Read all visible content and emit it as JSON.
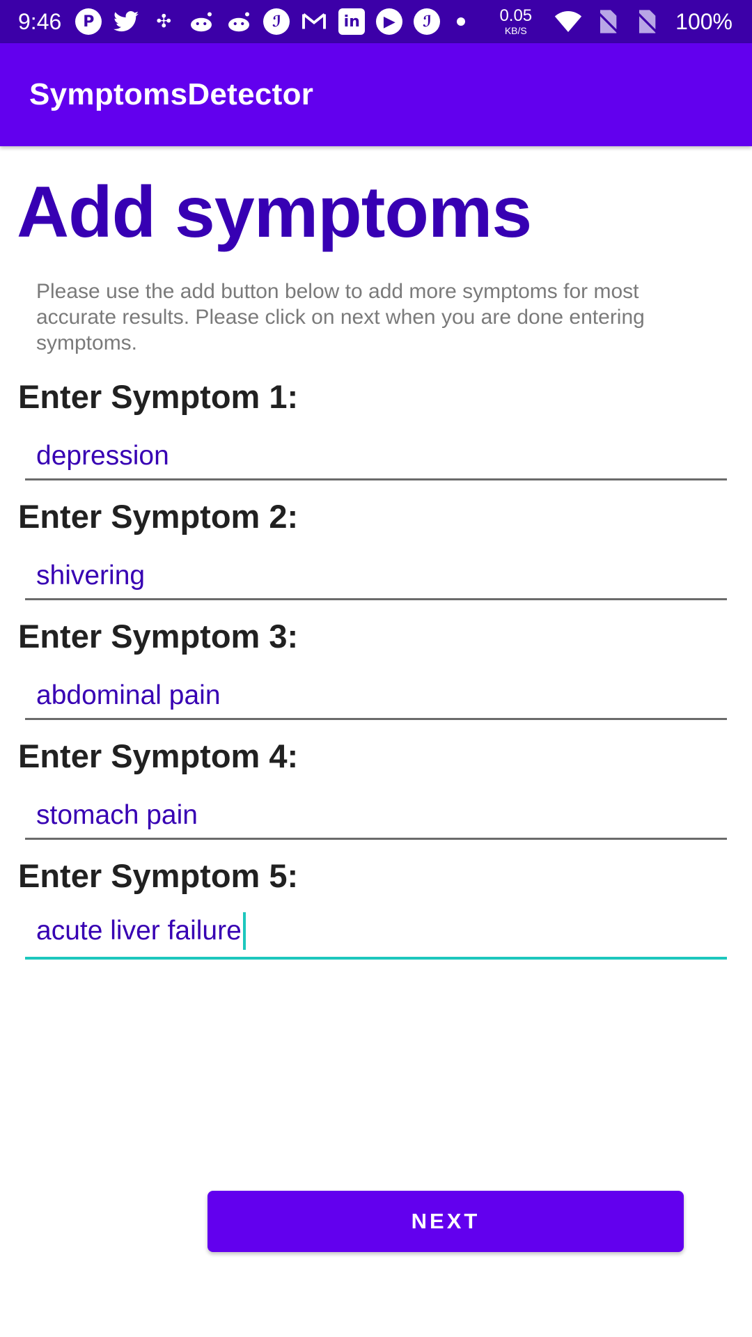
{
  "status_bar": {
    "time": "9:46",
    "notification_icons": [
      "pinterest-icon",
      "twitter-icon",
      "pinwheel-icon",
      "reddit-icon",
      "reddit-icon",
      "feather-icon",
      "gmail-icon",
      "linkedin-icon",
      "youtube-icon",
      "feather-icon",
      "dot-icon"
    ],
    "net_speed_value": "0.05",
    "net_speed_unit": "KB/S",
    "battery": "100%"
  },
  "app_bar": {
    "title": "SymptomsDetector"
  },
  "page": {
    "title": "Add symptoms",
    "instructions": "Please use the add button below to add more symptoms for most accurate results. Please click on next when you are done entering symptoms."
  },
  "symptoms": [
    {
      "label": "Enter Symptom 1:",
      "value": "depression"
    },
    {
      "label": "Enter Symptom 2:",
      "value": "shivering"
    },
    {
      "label": "Enter Symptom 3:",
      "value": "abdominal pain"
    },
    {
      "label": "Enter Symptom 4:",
      "value": "stomach pain"
    },
    {
      "label": "Enter Symptom 5:",
      "value": "acute liver failure"
    }
  ],
  "next_button": {
    "label": "NEXT"
  },
  "colors": {
    "status_bar": "#3c00a8",
    "primary": "#6200ee",
    "title_text": "#3700b3",
    "input_text": "#3700b3",
    "focus_accent": "#1dc7bd"
  }
}
